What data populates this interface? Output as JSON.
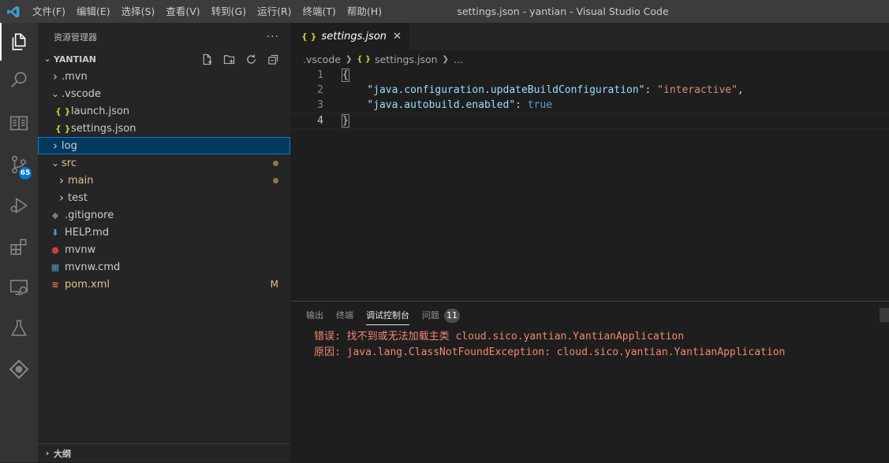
{
  "titlebar": {
    "menu": [
      "文件(F)",
      "编辑(E)",
      "选择(S)",
      "查看(V)",
      "转到(G)",
      "运行(R)",
      "终端(T)",
      "帮助(H)"
    ],
    "title": "settings.json - yantian - Visual Studio Code"
  },
  "activitybar": {
    "icons": [
      "files-icon",
      "search-icon",
      "book-icon",
      "source-control-icon",
      "run-debug-icon",
      "extensions-icon",
      "remote-explorer-icon",
      "testing-icon",
      "gitlens-icon"
    ],
    "scm_badge": "65"
  },
  "sidebar": {
    "header": "资源管理器",
    "more": "···",
    "section": "YANTIAN",
    "tree": [
      {
        "label": ".mvn",
        "type": "folder",
        "open": false,
        "indent": 0
      },
      {
        "label": ".vscode",
        "type": "folder",
        "open": true,
        "indent": 0
      },
      {
        "label": "launch.json",
        "type": "json",
        "indent": 1
      },
      {
        "label": "settings.json",
        "type": "json",
        "indent": 1
      },
      {
        "label": "log",
        "type": "folder",
        "open": false,
        "indent": 0,
        "selected": true
      },
      {
        "label": "src",
        "type": "folder",
        "open": true,
        "indent": 0,
        "modified": true,
        "deco": "dot"
      },
      {
        "label": "main",
        "type": "folder",
        "open": false,
        "indent": 1,
        "modified": true,
        "deco": "dot"
      },
      {
        "label": "test",
        "type": "folder",
        "open": false,
        "indent": 1
      },
      {
        "label": ".gitignore",
        "type": "gitignore",
        "indent": 0
      },
      {
        "label": "HELP.md",
        "type": "md",
        "indent": 0
      },
      {
        "label": "mvnw",
        "type": "mvnw",
        "indent": 0
      },
      {
        "label": "mvnw.cmd",
        "type": "cmd",
        "indent": 0
      },
      {
        "label": "pom.xml",
        "type": "xml",
        "indent": 0,
        "modified": true,
        "deco": "M"
      }
    ],
    "outline": "大纲"
  },
  "editor": {
    "tab": {
      "label": "settings.json",
      "close": "✕"
    },
    "breadcrumb": [
      ".vscode",
      "settings.json",
      "..."
    ],
    "lines": [
      "1",
      "2",
      "3",
      "4"
    ],
    "code": {
      "open_brace": "{",
      "key1": "\"java.configuration.updateBuildConfiguration\"",
      "val1": "\"interactive\"",
      "key2": "\"java.autobuild.enabled\"",
      "val2": "true",
      "close_brace": "}"
    }
  },
  "panel": {
    "tabs": [
      "输出",
      "终端",
      "调试控制台",
      "问题"
    ],
    "active_tab": "调试控制台",
    "problems_count": "11",
    "output": [
      "错误: 找不到或无法加载主类 cloud.sico.yantian.YantianApplication",
      "原因: java.lang.ClassNotFoundException: cloud.sico.yantian.YantianApplication"
    ]
  }
}
